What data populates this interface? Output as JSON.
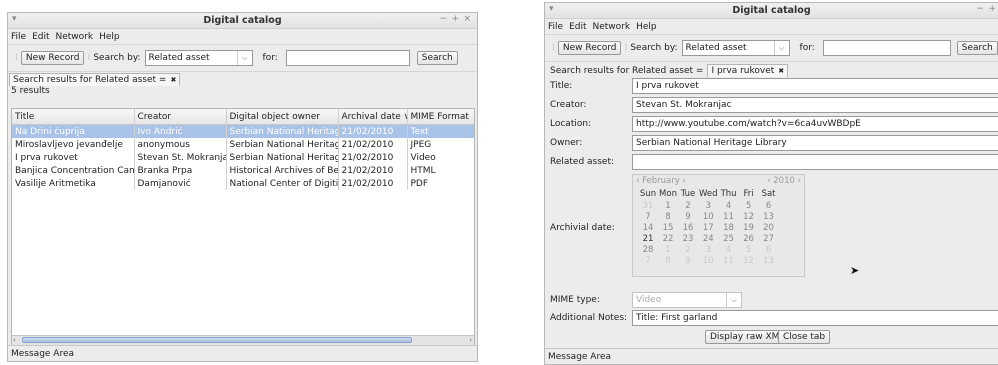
{
  "left": {
    "title": "Digital catalog",
    "window_controls": [
      "−",
      "+",
      "×"
    ],
    "menu": [
      "File",
      "Edit",
      "Network",
      "Help"
    ],
    "toolbar": {
      "new_record": "New Record",
      "search_by": "Search by:",
      "search_field": "Related asset",
      "for": "for:",
      "search_value": "",
      "search_btn": "Search"
    },
    "tab_label": "Search results for Related asset =",
    "tab_close": "✖",
    "results_count": "5 results",
    "columns": [
      "Title",
      "Creator",
      "Digital object owner",
      "Archival date ∨",
      "MIME Format"
    ],
    "rows": [
      [
        "Na Drini ćuprija",
        "Ivo Andrić",
        "Serbian National Heritage",
        "21/02/2010",
        "Text"
      ],
      [
        "Miroslavljevo jevanđelje",
        "anonymous",
        "Serbian National Heritage",
        "21/02/2010",
        "JPEG"
      ],
      [
        "I prva rukovet",
        "Stevan St. Mokranjac",
        "Serbian National Heritage",
        "21/02/2010",
        "Video"
      ],
      [
        "Banjica Concentration Camp",
        "Branka Prpa",
        "Historical Archives of Belgrade",
        "21/02/2010",
        "HTML"
      ],
      [
        "Vasilije Aritmetika",
        "Damjanović",
        "National Center of Digitization",
        "21/02/2010",
        "PDF"
      ]
    ],
    "status": "Message Area"
  },
  "right": {
    "title": "Digital catalog",
    "window_controls": [
      "−",
      "+"
    ],
    "menu": [
      "File",
      "Edit",
      "Network",
      "Help"
    ],
    "toolbar": {
      "new_record": "New Record",
      "search_by": "Search by:",
      "search_field": "Related asset",
      "for": "for:",
      "search_value": "",
      "search_btn": "Search"
    },
    "tab1": "Search results for Related asset =",
    "tab2": "I prva rukovet",
    "tab_close": "✖",
    "fields": {
      "title_label": "Title:",
      "title_value": "I prva rukovet",
      "creator_label": "Creator:",
      "creator_value": "Stevan St. Mokranjac",
      "location_label": "Location:",
      "location_value": "http://www.youtube.com/watch?v=6ca4uvWBDpE",
      "owner_label": "Owner:",
      "owner_value": "Serbian National Heritage Library",
      "related_label": "Related asset:",
      "related_value": "",
      "archival_label": "Archivial date:",
      "mime_label": "MIME type:",
      "mime_value": "Video",
      "notes_label": "Additional Notes:",
      "notes_value": "Title: First garland"
    },
    "calendar": {
      "month": "February",
      "year": "2010",
      "weekdays": [
        "Sun",
        "Mon",
        "Tue",
        "Wed",
        "Thu",
        "Fri",
        "Sat"
      ],
      "weeks": [
        [
          "31",
          "1",
          "2",
          "3",
          "4",
          "5",
          "6"
        ],
        [
          "7",
          "8",
          "9",
          "10",
          "11",
          "12",
          "13"
        ],
        [
          "14",
          "15",
          "16",
          "17",
          "18",
          "19",
          "20"
        ],
        [
          "21",
          "22",
          "23",
          "24",
          "25",
          "26",
          "27"
        ],
        [
          "28",
          "1",
          "2",
          "3",
          "4",
          "5",
          "6"
        ],
        [
          "7",
          "8",
          "9",
          "10",
          "11",
          "12",
          "13"
        ]
      ],
      "selected_day": "21"
    },
    "buttons": {
      "raw_xml": "Display raw XML",
      "close_tab": "Close tab"
    },
    "status": "Message Area"
  }
}
